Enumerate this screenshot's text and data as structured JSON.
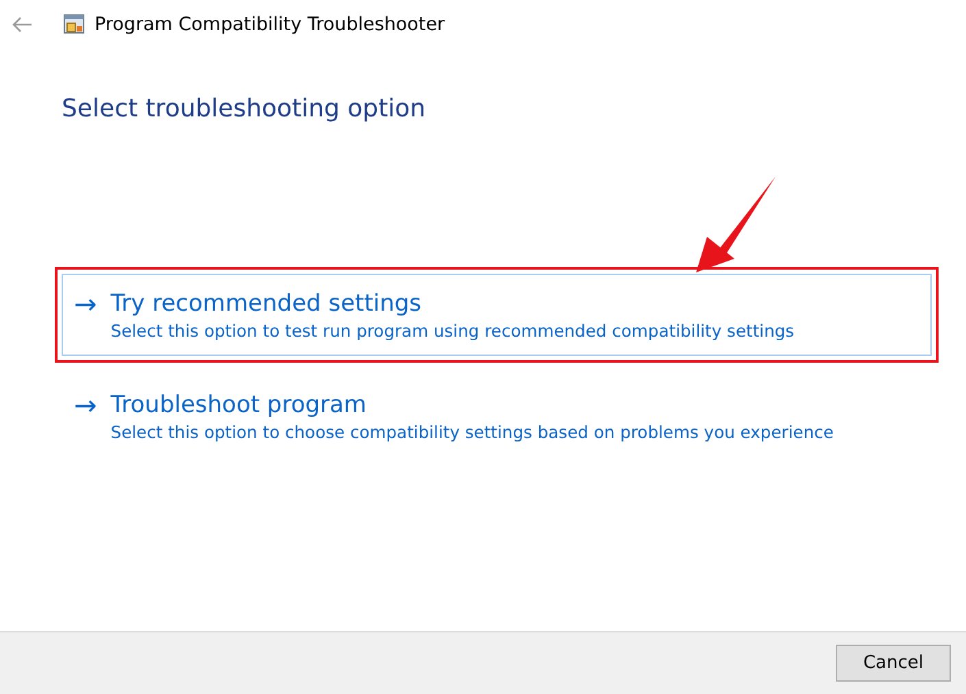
{
  "window": {
    "title": "Program Compatibility Troubleshooter"
  },
  "heading": "Select troubleshooting option",
  "options": [
    {
      "arrow": "→",
      "title": "Try recommended settings",
      "description": "Select this option to test run program using recommended compatibility settings",
      "selected": true,
      "highlighted": true
    },
    {
      "arrow": "→",
      "title": "Troubleshoot program",
      "description": "Select this option to choose compatibility settings based on problems you experience",
      "selected": false,
      "highlighted": false
    }
  ],
  "buttons": [
    "Cancel"
  ]
}
